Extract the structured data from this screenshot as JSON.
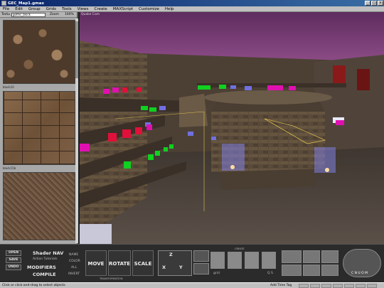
{
  "window": {
    "title": "GEC_Map1.gmax",
    "controls": [
      "_",
      "□",
      "×"
    ]
  },
  "menu": [
    "File",
    "Edit",
    "Group",
    "Grids",
    "Tools",
    "Views",
    "Create",
    "MAXScript",
    "Customize",
    "Help"
  ],
  "texture_panel": {
    "textures_label": "Textu",
    "texture_select": "gothic_block",
    "zoom_label": "Zoom",
    "zoom_value": "100%",
    "swatches": [
      {
        "caption": "",
        "icon": "stone-rubble-texture"
      },
      {
        "caption": "block10",
        "icon": "stone-block-texture"
      },
      {
        "caption": "block15b",
        "icon": "rock-texture"
      }
    ]
  },
  "viewport": {
    "label": "Quake Cam",
    "colors": {
      "sky": "#7a3d73",
      "wall": "#564636",
      "floor": "#4a4038",
      "red": "#e0103a",
      "magenta": "#e010b0",
      "green": "#10d020",
      "blue": "#7070e0"
    }
  },
  "bottom": {
    "open": "OPEN",
    "save": "SAVE",
    "undo": "UNDO",
    "shader_nav": "Shader NAV",
    "action_tutorials": "Action Tutorials",
    "modifiers": "MODIFIERS",
    "compile": "COMPILE",
    "name": "NAME",
    "color": "COLOR",
    "all": "ALL",
    "invert": "INVERT",
    "move": "MOVE",
    "rotate": "ROTATE",
    "scale": "SCALE",
    "transformation": "TRANSFORMATION",
    "axis_z": "Z",
    "axis_x": "X",
    "axis_y": "Y",
    "create": "CREATE",
    "grid": "grid",
    "qs": "Q S",
    "nav_letters": "C N U O M"
  },
  "status": {
    "prompt": "Click or click-and-drag to select objects",
    "add_time_tag": "Add Time Tag"
  }
}
